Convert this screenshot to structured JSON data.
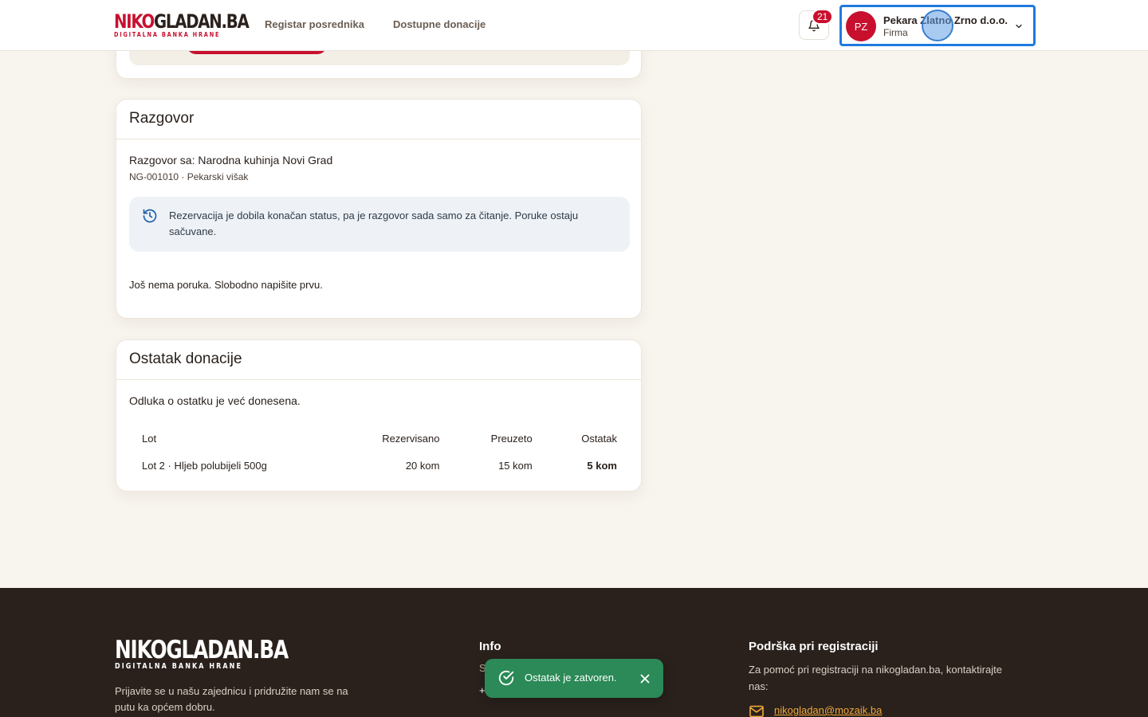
{
  "header": {
    "logo": {
      "part1": "NIKO",
      "part2": "GLADAN.BA",
      "tagline": "DIGITALNA BANKA HRANE"
    },
    "nav": [
      {
        "label": "Registar posrednika"
      },
      {
        "label": "Dostupne donacije"
      }
    ],
    "notifications": {
      "count": "21"
    },
    "user": {
      "initials": "PZ",
      "name": "Pekara Zlatno Zrno d.o.o.",
      "role": "Firma"
    }
  },
  "conversation": {
    "title": "Razgovor",
    "with": "Razgovor sa: Narodna kuhinja Novi Grad",
    "meta": "NG-001010 · Pekarski višak",
    "notice": "Rezervacija je dobila konačan status, pa je razgovor sada samo za čitanje. Poruke ostaju sačuvane.",
    "empty": "Još nema poruka. Slobodno napišite prvu."
  },
  "remainder": {
    "title": "Ostatak donacije",
    "decision": "Odluka o ostatku je već donesena.",
    "columns": [
      "Lot",
      "Rezervisano",
      "Preuzeto",
      "Ostatak"
    ],
    "rows": [
      {
        "lot": "Lot 2 · Hljeb polubijeli 500g",
        "reserved": "20 kom",
        "collected": "15 kom",
        "remaining": "5 kom"
      }
    ]
  },
  "footer": {
    "logo": {
      "main": "NIKOGLADAN.BA",
      "tagline": "DIGITALNA BANKA HRANE"
    },
    "description": "Prijavite se u našu zajednicu i pridružite nam se na putu ka općem dobru.",
    "info": {
      "title": "Info",
      "line1": "S",
      "line2": "+"
    },
    "support": {
      "title": "Podrška pri registraciji",
      "text": "Za pomoć pri registraciji na nikogladan.ba, kontaktirajte nas:",
      "email": "nikogladan@mozaik.ba"
    }
  },
  "toast": {
    "message": "Ostatak je zatvoren."
  },
  "colors": {
    "brand": "#c8102e",
    "footer_bg": "#2a211c",
    "toast_bg": "#2b8a57",
    "focus_ring": "#1f7ae0",
    "link": "#f0a93a"
  }
}
